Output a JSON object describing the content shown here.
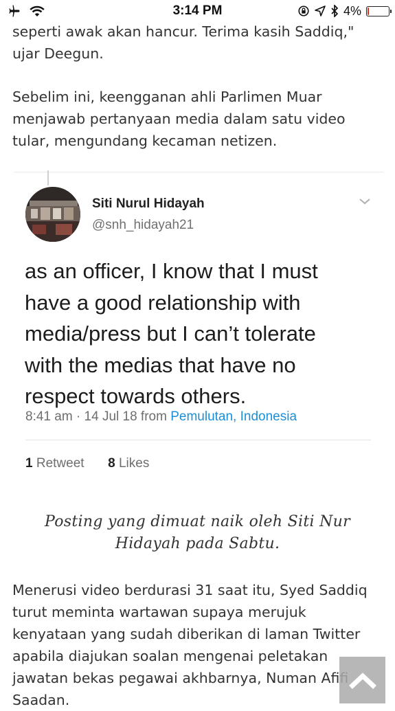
{
  "status_bar": {
    "time": "3:14 PM",
    "battery_percent": "4%",
    "battery_level": 0.04,
    "icons": [
      "airplane-icon",
      "wifi-icon",
      "orientation-lock-icon",
      "location-icon",
      "bluetooth-icon",
      "battery-icon"
    ]
  },
  "article": {
    "para_top": "seperti awak akan hancur. Terima kasih Saddiq,\"\nujar Deegun.",
    "para_2": "Sebelim ini, keengganan ahli Parlimen Muar\nmenjawab pertanyaan media dalam satu video\ntular, mengundang kecaman netizen.",
    "caption": "Posting yang dimuat naik oleh Siti Nur\nHidayah pada Sabtu.",
    "para_3": "Menerusi video berdurasi 31 saat itu, Syed Saddiq\nturut meminta wartawan supaya merujuk\nkenyataan yang sudah diberikan di laman Twitter\napabila diajukan soalan mengenai peletakan\njawatan bekas pegawai akhbarnya, Numan Afifi\nSaadan."
  },
  "tweet": {
    "author_name": "Siti Nurul Hidayah",
    "author_handle": "@snh_hidayah21",
    "text": "as an officer, I know that I must\nhave a good relationship with\nmedia/press but I can’t tolerate\nwith the medias that have no\nrespect towards others.",
    "timestamp": "8:41 am · 14 Jul 18 from ",
    "location": "Pemulutan, Indonesia",
    "retweet_count": "1",
    "retweet_label": " Retweet",
    "likes_count": "8",
    "likes_label": " Likes"
  },
  "colors": {
    "link_blue": "#1a8fd8",
    "battery_red": "#e0301e"
  }
}
